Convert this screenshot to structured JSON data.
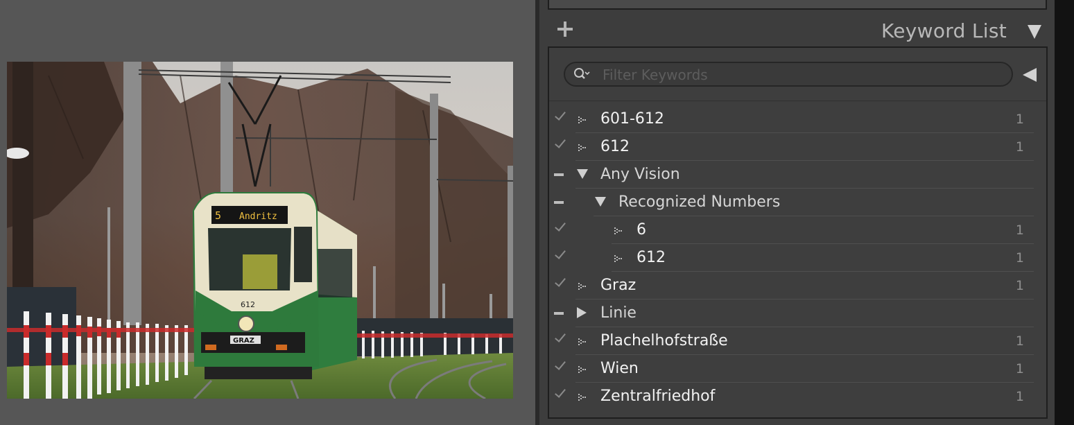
{
  "keyword_panel": {
    "title": "Keyword List",
    "filter": {
      "placeholder": "Filter Keywords",
      "value": ""
    },
    "keywords": [
      {
        "label": "601-612",
        "count": "1",
        "depth": 0,
        "marker": "check",
        "node": "leaf"
      },
      {
        "label": "612",
        "count": "1",
        "depth": 0,
        "marker": "check",
        "node": "leaf"
      },
      {
        "label": "Any Vision",
        "count": "",
        "depth": 0,
        "marker": "minus",
        "node": "expanded"
      },
      {
        "label": "Recognized Numbers",
        "count": "",
        "depth": 1,
        "marker": "minus",
        "node": "expanded"
      },
      {
        "label": "6",
        "count": "1",
        "depth": 2,
        "marker": "check",
        "node": "leaf"
      },
      {
        "label": "612",
        "count": "1",
        "depth": 2,
        "marker": "check",
        "node": "leaf"
      },
      {
        "label": "Graz",
        "count": "1",
        "depth": 0,
        "marker": "check",
        "node": "leaf"
      },
      {
        "label": "Linie",
        "count": "",
        "depth": 0,
        "marker": "minus",
        "node": "collapsed"
      },
      {
        "label": "Plachelhofstraße",
        "count": "1",
        "depth": 0,
        "marker": "check",
        "node": "leaf"
      },
      {
        "label": "Wien",
        "count": "1",
        "depth": 0,
        "marker": "check",
        "node": "leaf"
      },
      {
        "label": "Zentralfriedhof",
        "count": "1",
        "depth": 0,
        "marker": "check",
        "node": "leaf"
      }
    ]
  },
  "photo": {
    "destination_display": "Andritz",
    "route_number": "5",
    "tram_number": "612",
    "front_badge": "GRAZ"
  },
  "colors": {
    "background": "#565656",
    "panel": "#3d3d3d",
    "tram_green": "#2e7a3c",
    "tram_cream": "#e8e2c8"
  }
}
